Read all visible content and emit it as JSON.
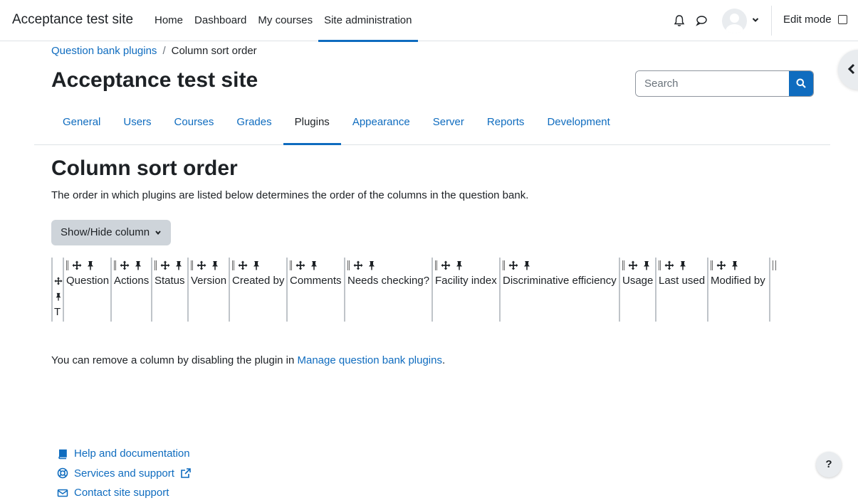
{
  "navbar": {
    "brand": "Acceptance test site",
    "items": [
      {
        "label": "Home",
        "active": false
      },
      {
        "label": "Dashboard",
        "active": false
      },
      {
        "label": "My courses",
        "active": false
      },
      {
        "label": "Site administration",
        "active": true
      }
    ],
    "edit_mode_label": "Edit mode",
    "icons": {
      "notifications": "bell-icon",
      "messages": "chat-icon",
      "user_menu": "avatar",
      "dropdown": "chevron-down-icon"
    }
  },
  "breadcrumb": {
    "parent": "Question bank plugins",
    "separator": "/",
    "current": "Column sort order"
  },
  "header": {
    "title": "Acceptance test site"
  },
  "search": {
    "placeholder": "Search"
  },
  "secondary_nav": {
    "tabs": [
      {
        "label": "General",
        "active": false
      },
      {
        "label": "Users",
        "active": false
      },
      {
        "label": "Courses",
        "active": false
      },
      {
        "label": "Grades",
        "active": false
      },
      {
        "label": "Plugins",
        "active": true
      },
      {
        "label": "Appearance",
        "active": false
      },
      {
        "label": "Server",
        "active": false
      },
      {
        "label": "Reports",
        "active": false
      },
      {
        "label": "Development",
        "active": false
      }
    ]
  },
  "main": {
    "heading": "Column sort order",
    "description": "The order in which plugins are listed below determines the order of the columns in the question bank.",
    "show_hide_label": "Show/Hide column",
    "columns": [
      {
        "label": "T"
      },
      {
        "label": "Question"
      },
      {
        "label": "Actions"
      },
      {
        "label": "Status"
      },
      {
        "label": "Version"
      },
      {
        "label": "Created by"
      },
      {
        "label": "Comments"
      },
      {
        "label": "Needs checking?"
      },
      {
        "label": "Facility index"
      },
      {
        "label": "Discriminative efficiency"
      },
      {
        "label": "Usage"
      },
      {
        "label": "Last used"
      },
      {
        "label": "Modified by"
      }
    ],
    "note_prefix": "You can remove a column by disabling the plugin in ",
    "note_link": "Manage question bank plugins",
    "note_suffix": "."
  },
  "footer": {
    "links": [
      {
        "label": "Help and documentation",
        "icon": "book-icon"
      },
      {
        "label": "Services and support",
        "icon": "lifebuoy-icon",
        "external": true
      },
      {
        "label": "Contact site support",
        "icon": "envelope-icon"
      }
    ],
    "help_button": "?"
  },
  "colors": {
    "link": "#0f6cbf",
    "text": "#1d2125",
    "button_secondary": "#ced4da"
  }
}
